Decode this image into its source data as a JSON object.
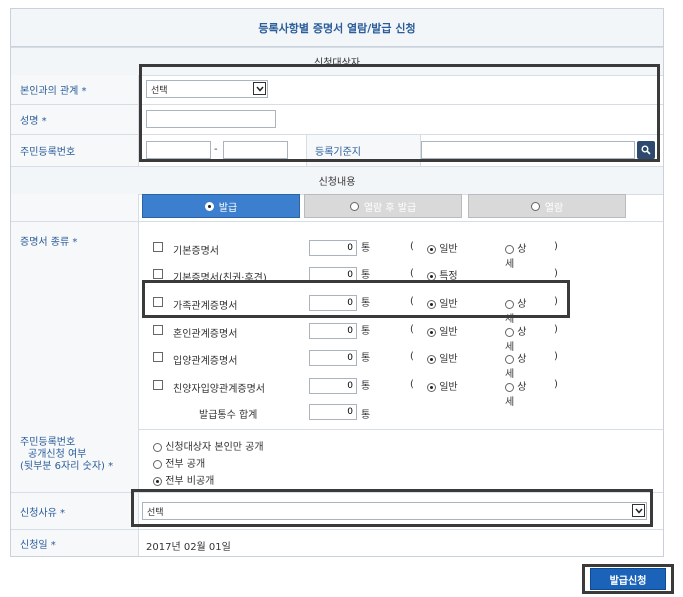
{
  "title": "등록사항별 증명서 열람/발급 신청",
  "sections": {
    "applicant": "신청대상자",
    "content": "신청내용"
  },
  "applicant": {
    "relation_label": "본인과의 관계 *",
    "relation_value": "선택",
    "name_label": "성명 *",
    "rrn_label": "주민등록번호",
    "rrn_sep": "-",
    "base_label": "등록기준지"
  },
  "tabs": [
    {
      "label": "발급",
      "active": true
    },
    {
      "label": "열람 후 발급",
      "active": false
    },
    {
      "label": "열람",
      "active": false
    }
  ],
  "cert_type_label": "증명서 종류 *",
  "certs": [
    {
      "name": "기본증명서",
      "count": "0",
      "unit": "통",
      "open": "(",
      "opt1": "일반",
      "opt2": "상세",
      "close": ")"
    },
    {
      "name": "기본증명서(친권·후견)",
      "count": "0",
      "unit": "통",
      "open": "(",
      "opt1": "특정",
      "opt2": "",
      "close": ")"
    },
    {
      "name": "가족관계증명서",
      "count": "0",
      "unit": "통",
      "open": "(",
      "opt1": "일반",
      "opt2": "상세",
      "close": ")"
    },
    {
      "name": "혼인관계증명서",
      "count": "0",
      "unit": "통",
      "open": "(",
      "opt1": "일반",
      "opt2": "상세",
      "close": ")"
    },
    {
      "name": "입양관계증명서",
      "count": "0",
      "unit": "통",
      "open": "(",
      "opt1": "일반",
      "opt2": "상세",
      "close": ")"
    },
    {
      "name": "친양자입양관계증명서",
      "count": "0",
      "unit": "통",
      "open": "(",
      "opt1": "일반",
      "opt2": "상세",
      "close": ")"
    }
  ],
  "total": {
    "label": "발급통수 합계",
    "count": "0",
    "unit": "통"
  },
  "disclosure": {
    "label_line1": "주민등록번호",
    "label_line2": "공개신청 여부",
    "label_line3": "(뒷부분 6자리 숫자) *",
    "options": [
      "신청대상자 본인만 공개",
      "전부 공개",
      "전부 비공개"
    ],
    "selected": 2
  },
  "reason": {
    "label": "신청사유 *",
    "value": "선택"
  },
  "date": {
    "label": "신청일 *",
    "value": "2017년 02월 01일"
  },
  "submit_label": "발급신청",
  "colors": {
    "accent": "#2b5d9a",
    "tab_active": "#3b7fce",
    "submit": "#1a63b8"
  },
  "icons": {
    "search": "search-icon",
    "dropdown": "chevron-down-icon"
  }
}
